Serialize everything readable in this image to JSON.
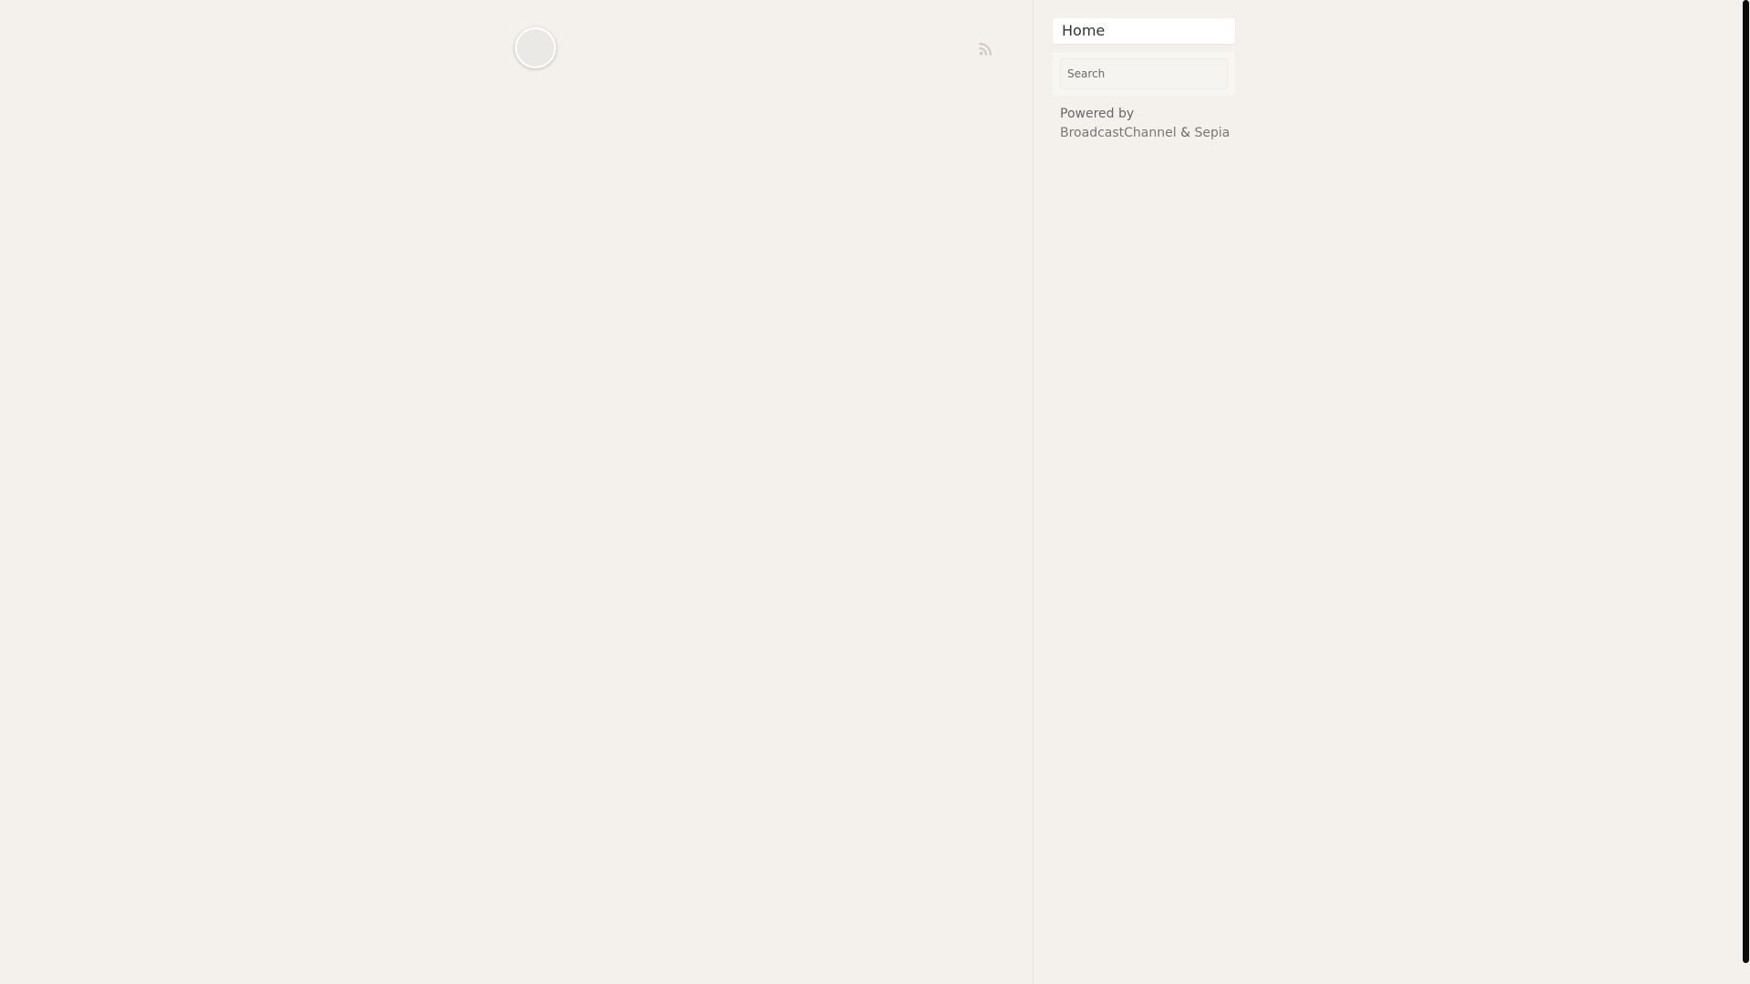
{
  "sidebar": {
    "nav": {
      "home_label": "Home"
    },
    "search": {
      "placeholder": "Search"
    },
    "footer": {
      "powered_by_text": "Powered by",
      "broadcast_channel_link": "BroadcastChannel",
      "ampersand": "&",
      "sepia_link": "Sepia"
    }
  },
  "header": {
    "avatar_icon": "avatar-placeholder",
    "rss_icon": "rss-icon"
  },
  "colors": {
    "background": "#f4f1ec",
    "panel": "#ffffff",
    "text": "#444444",
    "rss": "#cfcac3"
  }
}
